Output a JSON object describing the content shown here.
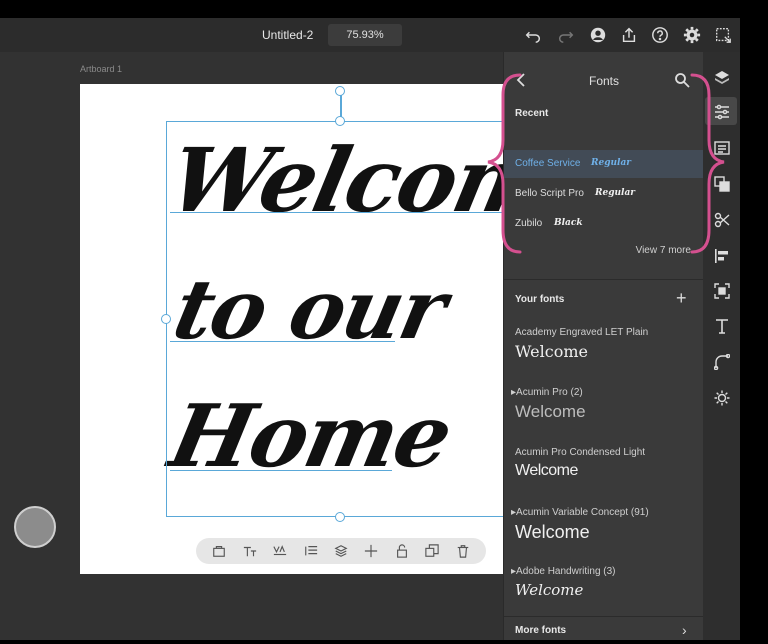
{
  "topbar": {
    "doc_title": "Untitled-2",
    "zoom": "75.93%",
    "icons": [
      "undo-icon",
      "redo-icon",
      "account-icon",
      "share-icon",
      "help-icon",
      "settings-icon",
      "artboard-export-icon"
    ]
  },
  "canvas": {
    "artboard_label": "Artboard 1",
    "text_lines": [
      "Welcome",
      "to our",
      "Home"
    ]
  },
  "canvas_toolbar": {
    "icons": [
      "component-icon",
      "text-size-icon",
      "kerning-icon",
      "list-icon",
      "layers-stack-icon",
      "move-icon",
      "lock-icon",
      "duplicate-icon",
      "delete-icon"
    ]
  },
  "fonts_panel": {
    "title": "Fonts",
    "recent_heading": "Recent",
    "recent": [
      {
        "name": "Coffee Service",
        "style": "Regular"
      },
      {
        "name": "Bello Script Pro",
        "style": "Regular"
      },
      {
        "name": "Zubilo",
        "style": "Black"
      }
    ],
    "view_more": "View 7 more",
    "your_fonts_heading": "Your fonts",
    "your_fonts": [
      {
        "name": "Academy Engraved LET Plain",
        "sample": "Welcome"
      },
      {
        "name": "▸Acumin Pro (2)",
        "sample": "Welcome"
      },
      {
        "name": "Acumin Pro Condensed Light",
        "sample": "Welcome"
      },
      {
        "name": "▸Acumin Variable Concept (91)",
        "sample": "Welcome"
      },
      {
        "name": "▸Adobe Handwriting (3)",
        "sample": "Welcome"
      }
    ],
    "more_fonts": "More fonts"
  },
  "rail": {
    "icons": [
      "layers-icon",
      "properties-icon",
      "text-frame-icon",
      "swap-icon",
      "scissors-icon",
      "align-icon",
      "focus-icon",
      "type-icon",
      "transform-icon",
      "sun-icon"
    ]
  },
  "annotation": {
    "brace_color": "#d4508f"
  }
}
